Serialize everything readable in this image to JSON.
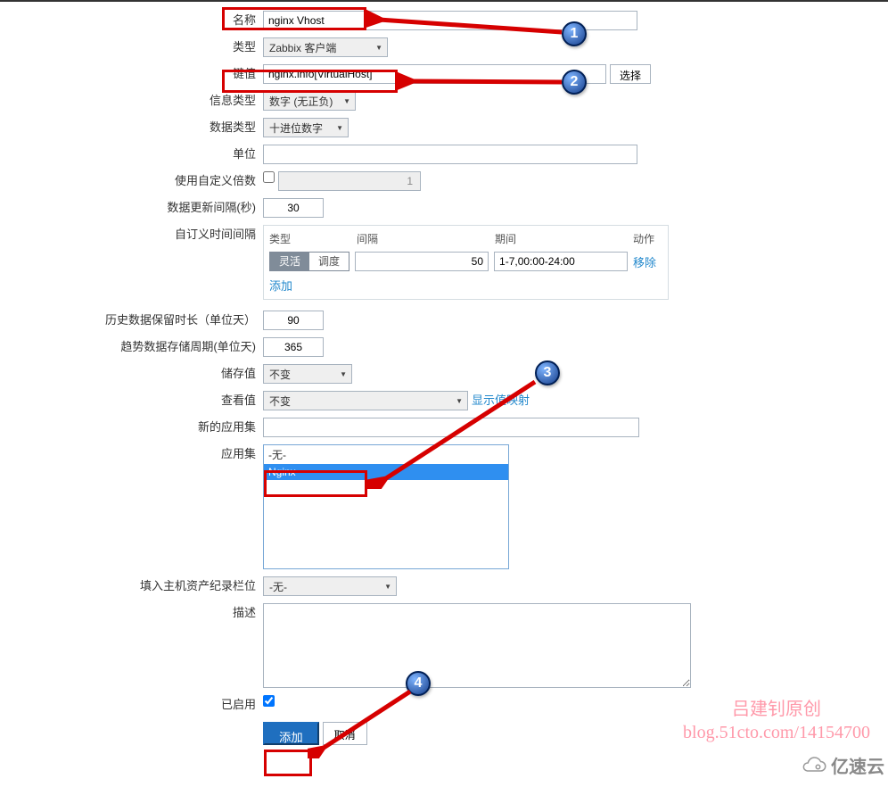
{
  "labels": {
    "name": "名称",
    "type": "类型",
    "key": "键值",
    "info_type": "信息类型",
    "data_type": "数据类型",
    "unit": "单位",
    "use_mult": "使用自定义倍数",
    "update_interval": "数据更新间隔(秒)",
    "custom_interval": "自订义时间间隔",
    "history": "历史数据保留时长（单位天）",
    "trends": "趋势数据存储周期(单位天)",
    "store": "储存值",
    "show": "查看值",
    "new_app": "新的应用集",
    "apps": "应用集",
    "host_inventory": "填入主机资产纪录栏位",
    "desc": "描述",
    "enabled": "已启用"
  },
  "fields": {
    "name": "nginx Vhost",
    "type": "Zabbix 客户端",
    "key": "nginx.info[VirtualHost]",
    "info_type": "数字 (无正负)",
    "data_type": "十进位数字",
    "unit": "",
    "mult_value": "1",
    "update_interval": "30",
    "history": "90",
    "trends": "365",
    "store": "不变",
    "show": "不变",
    "host_inv": "-无-",
    "new_app": "",
    "app_opts": [
      "-无-",
      "Nginx"
    ],
    "desc": ""
  },
  "interval": {
    "hdr_type": "类型",
    "hdr_interval": "间隔",
    "hdr_period": "期间",
    "hdr_action": "动作",
    "toggle1": "灵活",
    "toggle2": "调度",
    "interval_val": "50",
    "period_val": "1-7,00:00-24:00",
    "remove": "移除",
    "add": "添加"
  },
  "btn": {
    "choose": "选择",
    "show_mapping": "显示值映射",
    "add": "添加",
    "cancel": "取消"
  },
  "watermark": {
    "line1": "吕建钊原创",
    "line2": "blog.51cto.com/14154700",
    "brand": "亿速云"
  },
  "annotations": {
    "b1": "1",
    "b2": "2",
    "b3": "3",
    "b4": "4"
  }
}
